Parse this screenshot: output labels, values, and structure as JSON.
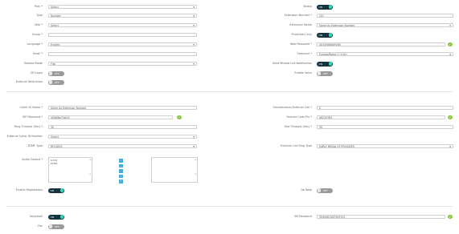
{
  "labels": {
    "plan": "Plan *",
    "type": "Type",
    "midi": "Midi *",
    "group": "Group *",
    "language": "Language *",
    "email": "Email *",
    "browse_mode": "Browse Mode",
    "off_login": "Off Login",
    "external_restriction": "External Restriction",
    "status": "Status",
    "extension_number": "Extension Number *",
    "extension_name": "Extension Name",
    "priority_only": "Prioritizes Only",
    "web_password": "Web Password *",
    "timezone": "Timezone *",
    "send_missed_call": "Send Missed Call Notification",
    "enable_voice": "Enable Voice",
    "caller_id_name": "Caller ID Name *",
    "sip_password": "SIP Password *",
    "ring_timeout": "Ring Timeout (Sec) *",
    "external_caller_id": "External Caller ID Number",
    "dtmf_type": "DTMF Type",
    "audio_codecs": "Audio Codecs *",
    "enable_registration": "Enable Registration",
    "simultaneous_external": "Simultaneous External Call *",
    "feature_code_pin": "Feature Code Pin *",
    "dial_timeout": "Dial Timeout (Sec) *",
    "external_call_ring_type": "External Call Ring Type",
    "de_nate": "De Nate",
    "voicemail": "Voicemail",
    "fax": "Fax",
    "vm_password": "VM Password"
  },
  "values": {
    "plan": "Select",
    "type": "Number",
    "midi": "Select",
    "group": "",
    "language": "English",
    "email": "",
    "browse_mode": "Flat",
    "extension_number": "101",
    "extension_name": "Same As Extension Number",
    "web_password": "4U3#08NDHVN5",
    "timezone": "Europe/Rome (+1:00)",
    "caller_id_name": "Same As Extension Number",
    "sip_password": "4QbB6a74#G2",
    "ring_timeout": "30",
    "external_caller_id": "Select",
    "dtmf_type": "RFC2833",
    "audio_codecs": [
      "G729",
      "PCMA"
    ],
    "simultaneous_external": "0",
    "feature_code_pin": "46229783",
    "dial_timeout": "30",
    "external_call_ring_type": "EARLY MEDIA OF PROVIDER",
    "vm_password": "3049461587509702"
  },
  "toggles": {
    "status": "ON",
    "priority_only": "ON",
    "send_missed_call": "ON",
    "enable_voice": "OFF",
    "off_login": "OFF",
    "external_restriction": "OFF",
    "enable_registration": "ON",
    "de_nate": "OFF",
    "voicemail": "ON",
    "fax": "OFF"
  },
  "icons": {
    "check": "✓",
    "move_arrows": [
      "«",
      "‹",
      "›",
      "»",
      "↑",
      "↓"
    ]
  },
  "colors": {
    "toggle_on": "#13343f",
    "knob": "#2dd8b6",
    "check": "#8cc63f",
    "move": "#3fa9d9"
  }
}
